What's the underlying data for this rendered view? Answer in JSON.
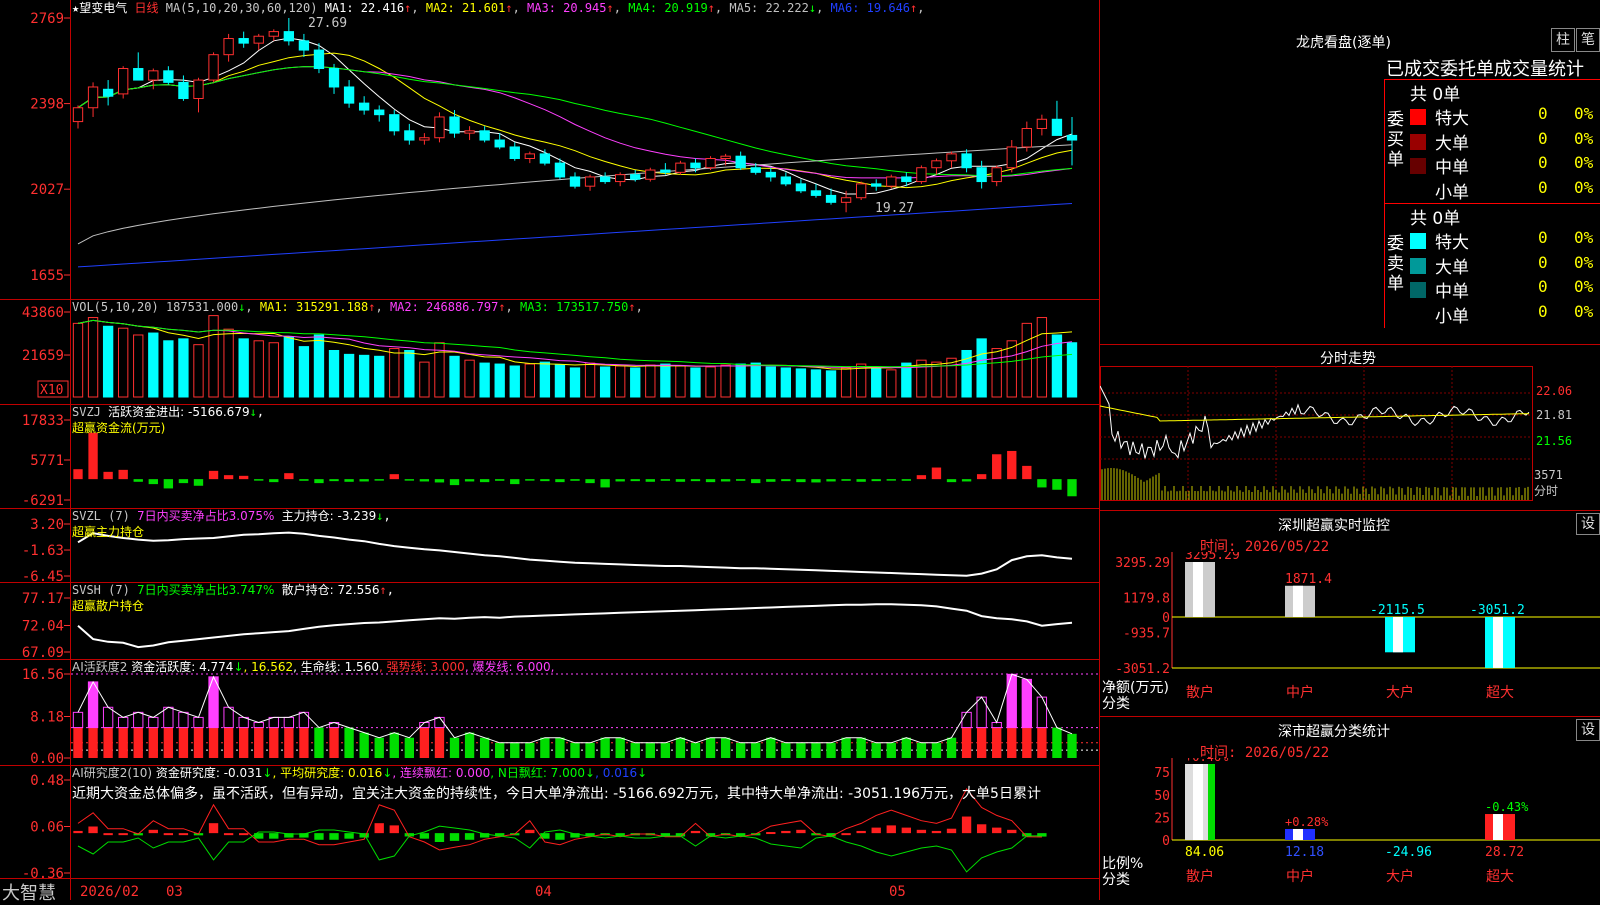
{
  "stock": {
    "name": "望变电气",
    "period": "日线",
    "star": "★"
  },
  "kline": {
    "ma_header": "MA(5,10,20,30,60,120)",
    "ma_values": [
      {
        "label": "MA1: 22.416",
        "arrow": "↑",
        "color": "#ffffff"
      },
      {
        "label": "MA2: 21.601",
        "arrow": "↑",
        "color": "#ffff00"
      },
      {
        "label": "MA3: 20.945",
        "arrow": "↑",
        "color": "#ff40ff"
      },
      {
        "label": "MA4: 20.919",
        "arrow": "↑",
        "color": "#00ff00"
      },
      {
        "label": "MA5: 22.222",
        "arrow": "↓",
        "color": "#c0c0c0"
      },
      {
        "label": "MA6: 19.646",
        "arrow": "↑",
        "color": "#2040ff"
      }
    ],
    "y_ticks": [
      "2769",
      "2398",
      "2027",
      "1655"
    ],
    "high_mark": "27.69",
    "low_mark": "19.27"
  },
  "volume": {
    "header": "VOL(5,10,20)",
    "values": [
      {
        "label": "187531.000",
        "arrow": "↓",
        "color": "#c8c8c8"
      },
      {
        "label": "MA1: 315291.188",
        "arrow": "↑",
        "color": "#ffff00"
      },
      {
        "label": "MA2: 246886.797",
        "arrow": "↑",
        "color": "#ff40ff"
      },
      {
        "label": "MA3: 173517.750",
        "arrow": "↑",
        "color": "#00ff00"
      }
    ],
    "y_ticks": [
      "43860",
      "21659"
    ],
    "unit": "X10"
  },
  "svzj": {
    "header": "SVZJ",
    "line1": "活跃资金进出: -5166.679",
    "arrow": "↓",
    "comma": ",",
    "line2": "超赢资金流(万元)",
    "y_ticks": [
      "17833",
      "5771",
      "-6291"
    ]
  },
  "svzl": {
    "header": "SVZL (7)",
    "desc": "7日内买卖净占比3.075%",
    "value": "主力持仓: -3.239",
    "arrow": "↓",
    "comma": ",",
    "line2": "超赢主力持仓",
    "y_ticks": [
      "3.20",
      "-1.63",
      "-6.45"
    ]
  },
  "svsh": {
    "header": "SVSH (7)",
    "desc": "7日内买卖净占比3.747%",
    "value": "散户持仓: 72.556",
    "arrow": "↑",
    "comma": ",",
    "line2": "超赢散户持仓",
    "y_ticks": [
      "77.17",
      "72.04",
      "67.09"
    ]
  },
  "ai_active": {
    "header": "AI活跃度2",
    "parts": [
      {
        "label": "资金活跃度: 4.774",
        "arrow": "↓",
        "color": "#ffffff"
      },
      {
        "label": ", 16.562",
        "arrow": "",
        "color": "#ffff00"
      },
      {
        "label": ", 生命线: 1.560",
        "arrow": "",
        "color": "#ffffff"
      },
      {
        "label": ", 强势线: 3.000",
        "arrow": "",
        "color": "#ff3030"
      },
      {
        "label": ", 爆发线: 6.000,",
        "arrow": "",
        "color": "#ff40ff"
      }
    ],
    "y_ticks": [
      "16.56",
      "8.18",
      "0.00"
    ]
  },
  "ai_research": {
    "header": "AI研究度2(10)",
    "parts": [
      {
        "label": "资金研究度: -0.031",
        "arrow": "↓",
        "color": "#ffffff"
      },
      {
        "label": ", 平均研究度: 0.016",
        "arrow": "↓",
        "color": "#ffff00"
      },
      {
        "label": ", 连续飘红: 0.000",
        "arrow": "",
        "color": "#ff40ff"
      },
      {
        "label": ", N日飘红: 7.000",
        "arrow": "↓",
        "color": "#00ff00"
      },
      {
        "label": ", 0.016",
        "arrow": "↓",
        "color": "#2040ff"
      }
    ],
    "comment": "近期大资金总体偏多，虽不活跃，但有异动，宜关注大资金的持续性，今日大单净流出: -5166.692万元，其中特大单净流出: -3051.196万元，大单5日累计",
    "y_ticks": [
      "0.48",
      "0.06",
      "-0.36"
    ]
  },
  "x_axis": {
    "labels": [
      "2026/02",
      "03",
      "04",
      "05"
    ],
    "brand": "大智慧"
  },
  "right": {
    "lhb_title": "龙虎看盘(逐单)",
    "btn1": "柱",
    "btn2": "笔",
    "stat_header": "已成交委托单成交量统计",
    "buy_side": "委买单",
    "sell_side": "委卖单",
    "buy_total": "共 0单",
    "sell_total": "共 0单",
    "buy_rows": [
      {
        "name": "特大",
        "count": "0",
        "pct": "0%",
        "color": "#ff0000"
      },
      {
        "name": "大单",
        "count": "0",
        "pct": "0%",
        "color": "#990000"
      },
      {
        "name": "中单",
        "count": "0",
        "pct": "0%",
        "color": "#660000"
      },
      {
        "name": "小单",
        "count": "0",
        "pct": "0%",
        "color": "#000000"
      }
    ],
    "sell_rows": [
      {
        "name": "特大",
        "count": "0",
        "pct": "0%",
        "color": "#00ffff"
      },
      {
        "name": "大单",
        "count": "0",
        "pct": "0%",
        "color": "#009999"
      },
      {
        "name": "中单",
        "count": "0",
        "pct": "0%",
        "color": "#006666"
      },
      {
        "name": "小单",
        "count": "0",
        "pct": "0%",
        "color": "#000000"
      }
    ],
    "intraday_title": "分时走势",
    "intraday_ticks": [
      "22.06",
      "21.81",
      "21.56",
      "3571",
      "分时"
    ],
    "monitor_title": "深圳超赢实时监控",
    "monitor_btn": "设",
    "monitor_time": "时间: 2026/05/22",
    "monitor_yticks": [
      "3295.29",
      "1179.8",
      "0",
      "-935.7",
      "-3051.2"
    ],
    "monitor_ylabel1": "净额(万元)",
    "monitor_ylabel2": "分类",
    "monitor_bars": [
      {
        "cat": "散户",
        "value": 3295.29,
        "label": "3295.29"
      },
      {
        "cat": "中户",
        "value": 1871.4,
        "label": "1871.4"
      },
      {
        "cat": "大户",
        "value": -2115.5,
        "label": "-2115.5"
      },
      {
        "cat": "超大",
        "value": -3051.2,
        "label": "-3051.2"
      }
    ],
    "cls_title": "深市超赢分类统计",
    "cls_btn": "设",
    "cls_time": "时间: 2026/05/22",
    "cls_yticks": [
      "75",
      "50",
      "25",
      "0"
    ],
    "cls_ylabel1": "比例%",
    "cls_ylabel2": "分类",
    "cls_bars": [
      {
        "cat": "散户",
        "value": 84.06,
        "pct": "+0.46%",
        "label": "84.06"
      },
      {
        "cat": "中户",
        "value": 12.18,
        "pct": "+0.28%",
        "label": "12.18"
      },
      {
        "cat": "大户",
        "value": -24.96,
        "pct": "",
        "label": "-24.96"
      },
      {
        "cat": "超大",
        "value": 28.72,
        "pct": "-0.43%",
        "label": "28.72"
      }
    ]
  },
  "chart_data": [
    {
      "type": "candlestick",
      "title": "望变电气 日线",
      "ylim": [
        16.55,
        27.69
      ],
      "ohlc": [
        [
          23.2,
          23.9,
          22.9,
          23.8
        ],
        [
          23.8,
          24.9,
          23.4,
          24.7
        ],
        [
          24.6,
          25.0,
          23.9,
          24.3
        ],
        [
          24.4,
          25.6,
          24.2,
          25.5
        ],
        [
          25.5,
          26.2,
          25.0,
          25.0
        ],
        [
          25.0,
          25.5,
          24.6,
          25.4
        ],
        [
          25.4,
          25.6,
          24.8,
          24.9
        ],
        [
          24.9,
          25.2,
          24.1,
          24.2
        ],
        [
          24.2,
          25.1,
          23.6,
          25.0
        ],
        [
          25.0,
          26.2,
          24.9,
          26.1
        ],
        [
          26.1,
          27.0,
          25.8,
          26.8
        ],
        [
          26.8,
          27.1,
          26.4,
          26.6
        ],
        [
          26.6,
          27.0,
          26.3,
          26.9
        ],
        [
          26.9,
          27.2,
          26.7,
          27.1
        ],
        [
          27.1,
          27.69,
          26.5,
          26.7
        ],
        [
          26.7,
          27.0,
          26.0,
          26.3
        ],
        [
          26.3,
          26.6,
          25.3,
          25.5
        ],
        [
          25.5,
          25.7,
          24.4,
          24.7
        ],
        [
          24.7,
          25.0,
          23.8,
          24.0
        ],
        [
          24.0,
          24.3,
          23.5,
          23.7
        ],
        [
          23.7,
          23.9,
          23.2,
          23.5
        ],
        [
          23.5,
          23.7,
          22.6,
          22.8
        ],
        [
          22.8,
          23.1,
          22.2,
          22.4
        ],
        [
          22.4,
          22.7,
          22.2,
          22.5
        ],
        [
          22.5,
          23.6,
          22.3,
          23.4
        ],
        [
          23.4,
          23.7,
          22.5,
          22.7
        ],
        [
          22.7,
          23.0,
          22.4,
          22.8
        ],
        [
          22.8,
          23.0,
          22.3,
          22.4
        ],
        [
          22.4,
          22.7,
          22.0,
          22.1
        ],
        [
          22.1,
          22.3,
          21.5,
          21.6
        ],
        [
          21.6,
          21.9,
          21.4,
          21.8
        ],
        [
          21.8,
          22.0,
          21.3,
          21.4
        ],
        [
          21.4,
          21.6,
          20.7,
          20.8
        ],
        [
          20.8,
          21.0,
          20.3,
          20.4
        ],
        [
          20.4,
          20.9,
          20.2,
          20.8
        ],
        [
          20.8,
          21.0,
          20.5,
          20.6
        ],
        [
          20.6,
          21.0,
          20.4,
          20.9
        ],
        [
          20.9,
          21.1,
          20.6,
          20.7
        ],
        [
          20.7,
          21.2,
          20.6,
          21.1
        ],
        [
          21.1,
          21.4,
          20.9,
          21.0
        ],
        [
          21.0,
          21.5,
          20.9,
          21.4
        ],
        [
          21.4,
          21.6,
          21.0,
          21.2
        ],
        [
          21.2,
          21.7,
          21.1,
          21.6
        ],
        [
          21.6,
          21.8,
          21.3,
          21.7
        ],
        [
          21.7,
          21.9,
          21.1,
          21.2
        ],
        [
          21.2,
          21.4,
          20.9,
          21.0
        ],
        [
          21.0,
          21.2,
          20.6,
          20.8
        ],
        [
          20.8,
          21.0,
          20.4,
          20.5
        ],
        [
          20.5,
          20.7,
          20.1,
          20.2
        ],
        [
          20.2,
          20.5,
          19.9,
          20.0
        ],
        [
          20.0,
          20.3,
          19.6,
          19.7
        ],
        [
          19.7,
          20.2,
          19.27,
          19.9
        ],
        [
          19.9,
          20.6,
          19.8,
          20.5
        ],
        [
          20.5,
          20.7,
          20.2,
          20.4
        ],
        [
          20.4,
          20.9,
          20.3,
          20.8
        ],
        [
          20.8,
          21.0,
          20.4,
          20.6
        ],
        [
          20.6,
          21.3,
          20.5,
          21.2
        ],
        [
          21.2,
          21.6,
          20.9,
          21.5
        ],
        [
          21.5,
          21.9,
          21.2,
          21.8
        ],
        [
          21.8,
          22.0,
          21.0,
          21.2
        ],
        [
          21.2,
          21.5,
          20.3,
          20.6
        ],
        [
          20.6,
          21.3,
          20.4,
          21.2
        ],
        [
          21.2,
          22.4,
          21.0,
          22.1
        ],
        [
          22.1,
          23.2,
          21.9,
          22.9
        ],
        [
          22.9,
          23.5,
          22.6,
          23.3
        ],
        [
          23.3,
          24.1,
          22.6,
          22.6
        ],
        [
          22.6,
          23.4,
          21.3,
          22.4
        ]
      ]
    },
    {
      "type": "bar",
      "title": "VOL(5,10,20)",
      "ylim": [
        0,
        43860
      ],
      "values": [
        38000,
        41000,
        36500,
        35500,
        32000,
        33000,
        29000,
        30000,
        27000,
        42000,
        35000,
        30000,
        29000,
        28000,
        31000,
        26000,
        32000,
        24000,
        22000,
        21500,
        21000,
        25000,
        24000,
        18000,
        28000,
        21000,
        19000,
        17500,
        17000,
        16000,
        17000,
        18000,
        16500,
        15000,
        17500,
        15500,
        16000,
        15000,
        16500,
        17000,
        16000,
        15000,
        15500,
        16500,
        17000,
        17500,
        15500,
        15000,
        14500,
        14000,
        13500,
        15000,
        17000,
        15500,
        14000,
        17500,
        19000,
        18000,
        20000,
        24000,
        30000,
        25000,
        29000,
        38000,
        41000,
        32000,
        28000
      ],
      "up": [
        true,
        true,
        false,
        true,
        true,
        false,
        false,
        false,
        true,
        true,
        true,
        false,
        true,
        true,
        false,
        false,
        false,
        false,
        false,
        false,
        false,
        true,
        false,
        true,
        true,
        false,
        true,
        false,
        false,
        false,
        true,
        false,
        false,
        false,
        true,
        false,
        true,
        false,
        true,
        false,
        true,
        false,
        true,
        true,
        false,
        false,
        false,
        false,
        false,
        false,
        false,
        true,
        true,
        false,
        true,
        false,
        true,
        true,
        true,
        false,
        false,
        true,
        true,
        true,
        true,
        false,
        false
      ]
    },
    {
      "type": "bar",
      "title": "SVZJ 活跃资金进出",
      "ylim": [
        -6291,
        17833
      ],
      "values": [
        3000,
        14000,
        2200,
        2800,
        -800,
        -1500,
        -2800,
        -1200,
        -2000,
        2500,
        1200,
        1000,
        -400,
        -900,
        1800,
        -500,
        -1200,
        -600,
        -800,
        -700,
        -400,
        1500,
        -400,
        -700,
        -1000,
        -1800,
        -700,
        -900,
        -500,
        -1500,
        -400,
        -600,
        -900,
        -500,
        -1200,
        -2500,
        -700,
        -600,
        -800,
        -500,
        -800,
        -600,
        -900,
        -700,
        -500,
        -1200,
        -800,
        -600,
        -900,
        -1000,
        -700,
        -500,
        -800,
        -600,
        -400,
        -500,
        1200,
        3500,
        -900,
        -700,
        1500,
        7500,
        8500,
        4000,
        -2500,
        -3200,
        -5167
      ]
    },
    {
      "type": "line",
      "title": "SVZL 主力持仓",
      "ylim": [
        -6.45,
        3.2
      ],
      "values": [
        -0.2,
        1.5,
        1.0,
        0.6,
        0.3,
        0.1,
        0.2,
        0.4,
        0.5,
        0.6,
        0.9,
        1.2,
        1.3,
        1.5,
        1.6,
        1.4,
        1.0,
        0.7,
        0.3,
        0.0,
        -0.5,
        -0.9,
        -1.2,
        -1.5,
        -1.7,
        -2.0,
        -2.3,
        -2.6,
        -2.8,
        -3.1,
        -3.4,
        -3.6,
        -3.8,
        -4.0,
        -4.1,
        -4.2,
        -4.3,
        -4.4,
        -4.5,
        -4.6,
        -4.6,
        -4.7,
        -4.8,
        -4.9,
        -5.0,
        -5.0,
        -5.1,
        -5.2,
        -5.3,
        -5.4,
        -5.5,
        -5.6,
        -5.7,
        -5.8,
        -5.9,
        -6.0,
        -6.1,
        -6.2,
        -6.3,
        -6.4,
        -6.0,
        -5.2,
        -3.5,
        -2.8,
        -2.6,
        -3.0,
        -3.239
      ]
    },
    {
      "type": "line",
      "title": "SVSH 散户持仓",
      "ylim": [
        67.09,
        77.17
      ],
      "values": [
        72.0,
        69.5,
        69.0,
        68.8,
        68.0,
        68.3,
        68.9,
        69.2,
        69.5,
        69.8,
        70.1,
        70.4,
        70.6,
        70.8,
        71.0,
        71.4,
        71.8,
        72.1,
        72.3,
        72.5,
        72.6,
        72.8,
        73.0,
        73.2,
        73.4,
        73.3,
        73.5,
        73.6,
        73.5,
        73.7,
        73.8,
        73.9,
        74.0,
        74.1,
        74.2,
        74.3,
        74.4,
        74.5,
        74.6,
        74.7,
        74.8,
        74.9,
        75.0,
        75.1,
        75.2,
        75.3,
        75.4,
        75.5,
        75.6,
        75.7,
        75.8,
        75.9,
        75.9,
        76.0,
        76.0,
        75.9,
        75.8,
        75.6,
        75.2,
        74.8,
        73.8,
        73.4,
        73.2,
        72.8,
        72.0,
        72.3,
        72.556
      ]
    },
    {
      "type": "bar",
      "title": "AI活跃度2 资金活跃度",
      "ylim": [
        0,
        16.56
      ],
      "values": [
        9,
        15,
        10,
        8,
        9,
        8,
        10,
        9,
        8,
        16,
        10,
        8,
        7,
        8,
        8,
        9,
        6,
        7,
        6,
        5,
        4,
        5,
        4,
        7,
        8,
        4,
        5,
        4,
        3,
        3,
        3,
        4,
        4,
        3,
        3,
        4,
        4,
        3,
        3,
        3,
        4,
        3,
        4,
        4,
        3,
        3,
        4,
        3,
        3,
        3,
        3,
        4,
        4,
        3,
        3,
        4,
        3,
        3,
        4,
        9,
        12,
        7,
        16.5,
        15.5,
        12,
        6,
        4.77
      ]
    },
    {
      "type": "bar",
      "title": "AI研究度2 资金研究度",
      "ylim": [
        -0.36,
        0.48
      ],
      "values": [
        0.02,
        0.06,
        0.0,
        0.0,
        -0.02,
        0.03,
        0.0,
        0.0,
        -0.02,
        0.09,
        0.0,
        0.0,
        -0.05,
        -0.05,
        -0.04,
        -0.04,
        -0.06,
        -0.06,
        -0.05,
        -0.04,
        0.09,
        0.07,
        -0.03,
        -0.05,
        -0.08,
        -0.07,
        -0.06,
        -0.04,
        -0.03,
        -0.02,
        0.03,
        -0.05,
        -0.06,
        -0.04,
        -0.03,
        -0.02,
        -0.03,
        -0.02,
        -0.02,
        -0.03,
        -0.03,
        0.02,
        -0.03,
        -0.02,
        -0.03,
        -0.02,
        0.01,
        0.02,
        0.03,
        -0.02,
        -0.03,
        0.0,
        0.02,
        0.05,
        0.07,
        0.05,
        0.03,
        0.02,
        0.04,
        0.15,
        0.08,
        0.05,
        0.03,
        -0.03,
        -0.031
      ]
    },
    {
      "type": "bar",
      "title": "深圳超赢实时监控",
      "categories": [
        "散户",
        "中户",
        "大户",
        "超大"
      ],
      "values": [
        3295.29,
        1871.4,
        -2115.5,
        -3051.2
      ],
      "ylabel": "净额(万元)",
      "ylim": [
        -3051.2,
        3295.29
      ]
    },
    {
      "type": "bar",
      "title": "深市超赢分类统计",
      "categories": [
        "散户",
        "中户",
        "大户",
        "超大"
      ],
      "values": [
        84.06,
        12.18,
        -24.96,
        28.72
      ],
      "ylabel": "比例%",
      "ylim": [
        0,
        84.06
      ]
    }
  ]
}
